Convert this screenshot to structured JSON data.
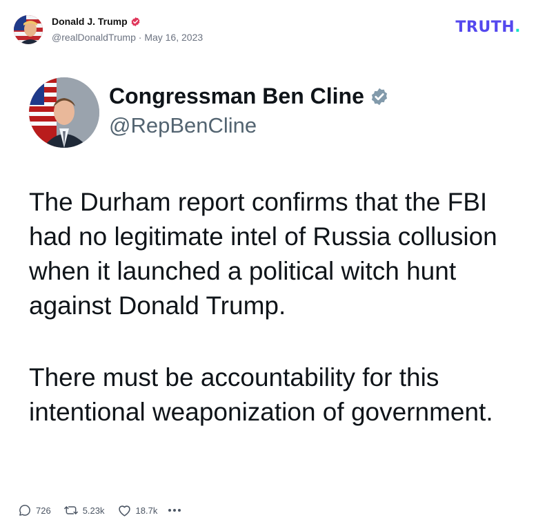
{
  "post": {
    "author_name": "Donald J. Trump",
    "handle": "@realDonaldTrump",
    "separator": "·",
    "date": "May 16, 2023",
    "meta_line": "@realDonaldTrump · May 16, 2023"
  },
  "brand": {
    "logo_text": "TRUTH",
    "logo_dot": ".",
    "primary_color": "#5448ee",
    "dot_color": "#17e2c7"
  },
  "embedded_tweet": {
    "name": "Congressman Ben Cline",
    "handle": "@RepBenCline",
    "paragraphs": [
      "The Durham report confirms that the FBI had no legitimate intel of Russia collusion when it launched a political witch hunt against Donald Trump.",
      "There must be accountability for this intentional weaponization of government."
    ]
  },
  "actions": {
    "replies": "726",
    "retruths": "5.23k",
    "likes": "18.7k"
  },
  "icons": {
    "verified": "verified-badge-icon",
    "reply": "comment-bubble-icon",
    "retruth": "repost-arrows-icon",
    "like": "heart-icon",
    "more": "ellipsis-icon"
  }
}
